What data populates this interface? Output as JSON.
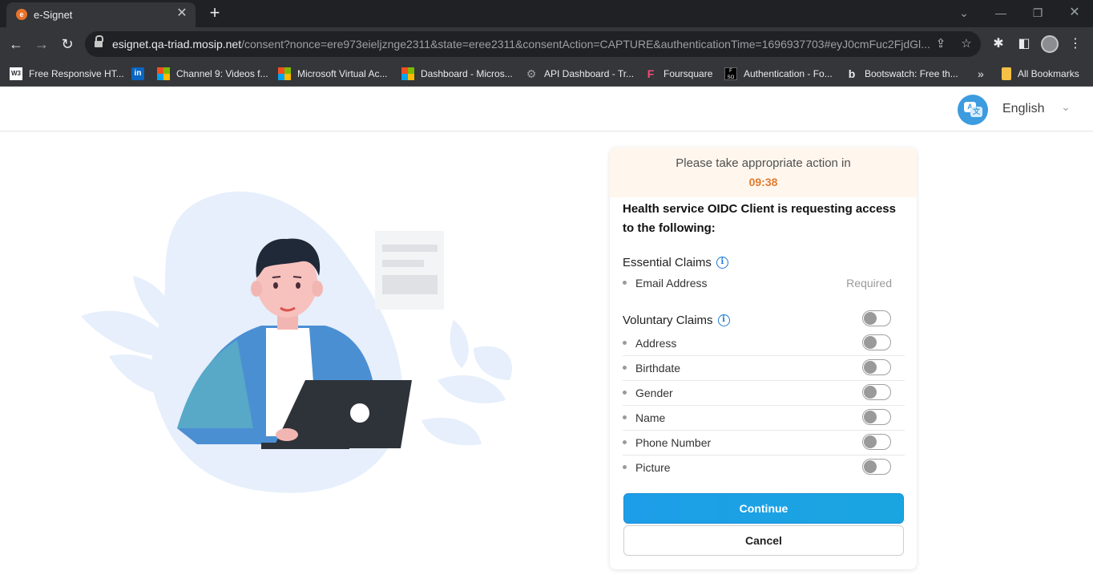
{
  "browser": {
    "tab_title": "e-Signet",
    "tab_favicon_letter": "e",
    "tab_close": "✕",
    "new_tab": "+",
    "url_host": "esignet.qa-triad.mosip.net",
    "url_path": "/consent?nonce=ere973eieljznge2311&state=eree2311&consentAction=CAPTURE&authenticationTime=1696937703#eyJ0cmFuc2FjdGl...",
    "bookmarks": [
      {
        "label": "Free Responsive HT...",
        "icon": "w3schools-icon"
      },
      {
        "label": "",
        "icon": "linkedin-icon"
      },
      {
        "label": "Channel 9: Videos f...",
        "icon": "microsoft-icon"
      },
      {
        "label": "Microsoft Virtual Ac...",
        "icon": "microsoft-icon"
      },
      {
        "label": "Dashboard - Micros...",
        "icon": "microsoft-icon"
      },
      {
        "label": "API Dashboard - Tr...",
        "icon": "gear-icon"
      },
      {
        "label": "Foursquare",
        "icon": "foursquare-icon"
      },
      {
        "label": "Authentication - Fo...",
        "icon": "fso-icon"
      },
      {
        "label": "Bootswatch: Free th...",
        "icon": "bootswatch-icon"
      }
    ],
    "bookmarks_overflow": "»",
    "all_bookmarks": "All Bookmarks"
  },
  "header": {
    "language": "English"
  },
  "consent": {
    "timer_label": "Please take appropriate action in",
    "timer_value": "09:38",
    "request_title": "Health service OIDC Client is requesting access to the following:",
    "essential_title": "Essential Claims",
    "essential_claims": [
      {
        "label": "Email Address",
        "status": "Required"
      }
    ],
    "voluntary_title": "Voluntary Claims",
    "voluntary_all_enabled": false,
    "voluntary_claims": [
      {
        "label": "Address",
        "enabled": false
      },
      {
        "label": "Birthdate",
        "enabled": false
      },
      {
        "label": "Gender",
        "enabled": false
      },
      {
        "label": "Name",
        "enabled": false
      },
      {
        "label": "Phone Number",
        "enabled": false
      },
      {
        "label": "Picture",
        "enabled": false
      }
    ],
    "continue_label": "Continue",
    "cancel_label": "Cancel"
  },
  "colors": {
    "accent": "#1d9ee8",
    "timer": "#e07b2c",
    "timer_bg": "#fff6ee"
  }
}
